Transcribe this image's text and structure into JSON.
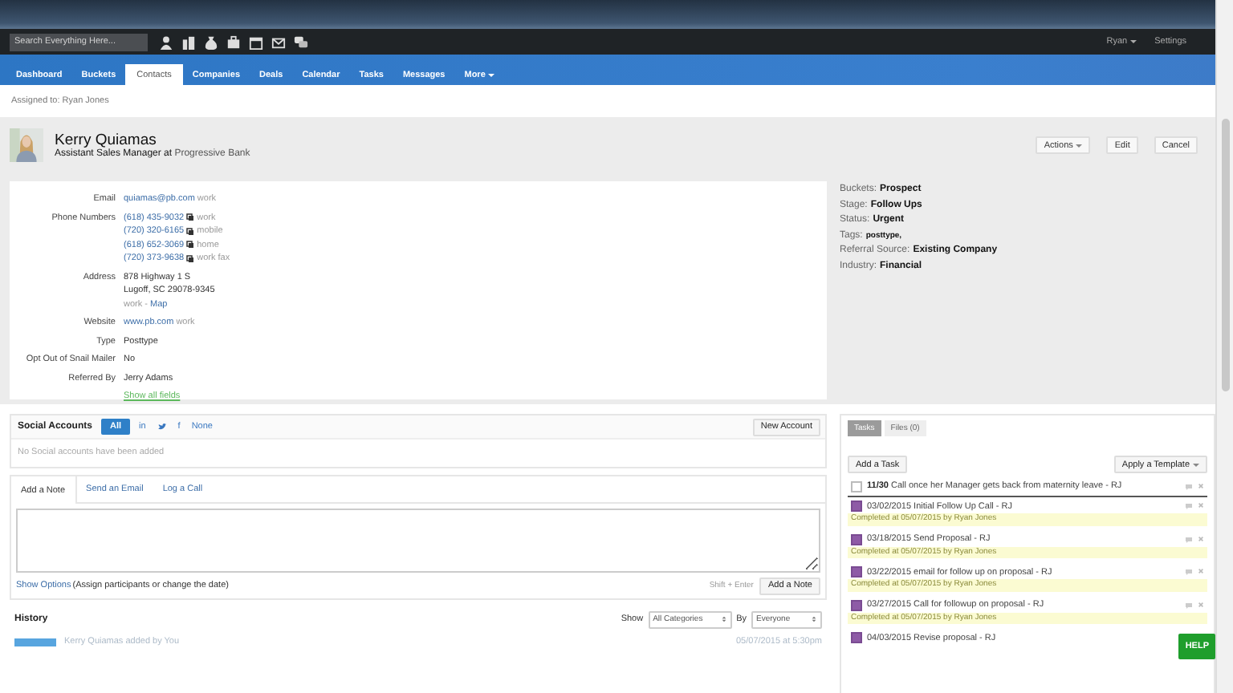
{
  "search": {
    "placeholder": "Search Everything Here..."
  },
  "user_menu": {
    "label": "Ryan",
    "kind": "dropdown"
  },
  "settings": "Settings",
  "nav": [
    {
      "label": "Dashboard",
      "selected": false,
      "kind": "link"
    },
    {
      "label": "Buckets",
      "selected": false,
      "kind": "link"
    },
    {
      "label": "Contacts",
      "selected": true,
      "kind": "link"
    },
    {
      "label": "Companies",
      "selected": false,
      "kind": "link"
    },
    {
      "label": "Deals",
      "selected": false,
      "kind": "link"
    },
    {
      "label": "Calendar",
      "selected": false,
      "kind": "link"
    },
    {
      "label": "Tasks",
      "selected": false,
      "kind": "link"
    },
    {
      "label": "Messages",
      "selected": false,
      "kind": "link"
    },
    {
      "label": "More",
      "selected": false,
      "kind": "dropdown"
    }
  ],
  "assigned": "Assigned to: Ryan Jones",
  "contact": {
    "name": "Kerry Quiamas",
    "title": "Assistant Sales Manager",
    "at": "at",
    "company": "Progressive Bank"
  },
  "actions": [
    {
      "label": "Actions",
      "kind": "dropdown"
    },
    {
      "label": "Edit",
      "kind": "button"
    },
    {
      "label": "Cancel",
      "kind": "button"
    }
  ],
  "fields": [
    {
      "label": "Email",
      "lines": [
        [
          {
            "text": "quiamas@pb.com",
            "kind": "link"
          },
          {
            "text": "work",
            "kind": "note"
          }
        ]
      ]
    },
    {
      "label": "Phone Numbers",
      "lines": [
        [
          {
            "text": "(618) 435-9032",
            "kind": "phone"
          },
          {
            "text": "work",
            "kind": "note"
          }
        ],
        [
          {
            "text": "(720) 320-6165",
            "kind": "phone"
          },
          {
            "text": "mobile",
            "kind": "note"
          }
        ],
        [
          {
            "text": "(618) 652-3069",
            "kind": "phone"
          },
          {
            "text": "home",
            "kind": "note"
          }
        ],
        [
          {
            "text": "(720) 373-9638",
            "kind": "phone"
          },
          {
            "text": "work fax",
            "kind": "note"
          }
        ]
      ]
    },
    {
      "label": "Address",
      "lines": [
        [
          {
            "text": "878 Highway 1 S",
            "kind": "plain"
          }
        ],
        [
          {
            "text": "Lugoff, SC 29078-9345",
            "kind": "plain"
          }
        ],
        [
          {
            "text": "work -",
            "kind": "note"
          },
          {
            "text": "Map",
            "kind": "link"
          }
        ]
      ]
    },
    {
      "label": "Website",
      "lines": [
        [
          {
            "text": "www.pb.com",
            "kind": "link"
          },
          {
            "text": "work",
            "kind": "note"
          }
        ]
      ]
    },
    {
      "label": "Type",
      "lines": [
        [
          {
            "text": "Posttype",
            "kind": "plain"
          }
        ]
      ]
    },
    {
      "label": "Opt Out of Snail Mailer",
      "lines": [
        [
          {
            "text": "No",
            "kind": "plain"
          }
        ]
      ]
    },
    {
      "label": "Referred By",
      "lines": [
        [
          {
            "text": "Jerry Adams",
            "kind": "plain"
          }
        ]
      ]
    }
  ],
  "show_all": "Show all fields",
  "summary": [
    {
      "label": "Buckets:",
      "value": "Prospect"
    },
    {
      "label": "Stage:",
      "value": "Follow Ups"
    },
    {
      "label": "Status:",
      "value": "Urgent"
    },
    {
      "label": "Tags:",
      "value": "posttype,"
    },
    {
      "label": "Referral Source:",
      "value": "Existing Company"
    },
    {
      "label": "Industry:",
      "value": "Financial"
    }
  ],
  "social": {
    "title": "Social Accounts",
    "filters": [
      {
        "kind": "text",
        "label": "All",
        "selected": true
      },
      {
        "kind": "text",
        "label": "in",
        "selected": false
      },
      {
        "kind": "bird",
        "selected": false
      },
      {
        "kind": "text",
        "label": "f",
        "selected": false
      },
      {
        "kind": "text",
        "label": "None",
        "selected": false
      }
    ],
    "new_account": "New Account",
    "empty": "No Social accounts have been added"
  },
  "note_tabs": [
    {
      "label": "Add a Note",
      "selected": true
    },
    {
      "label": "Send an Email",
      "selected": false
    },
    {
      "label": "Log a Call",
      "selected": false
    }
  ],
  "show_options": "Show Options",
  "options_hint": "(Assign participants or change the date)",
  "shortcut": "Shift + Enter",
  "add_note": "Add a Note",
  "history": {
    "title": "History",
    "show_label": "Show",
    "category": "All Categories",
    "by_label": "By",
    "person": "Everyone",
    "entry": {
      "text": "Kerry Quiamas added by You",
      "time": "05/07/2015 at 5:30pm"
    }
  },
  "task_tabs": [
    {
      "label": "Tasks",
      "selected": true
    },
    {
      "label": "Files (0)",
      "selected": false
    }
  ],
  "add_task": "Add a Task",
  "apply_template": "Apply a Template",
  "tasks": [
    {
      "date": "11/30",
      "text": "Call once her Manager gets back from maternity leave - RJ",
      "completed": false
    },
    {
      "date": "03/02/2015",
      "text": "Initial Follow Up Call - RJ",
      "completed": true,
      "note": "Completed at 05/07/2015 by Ryan Jones"
    },
    {
      "date": "03/18/2015",
      "text": "Send Proposal - RJ",
      "completed": true,
      "note": "Completed at 05/07/2015 by Ryan Jones"
    },
    {
      "date": "03/22/2015",
      "text": "email for follow up on proposal - RJ",
      "completed": true,
      "note": "Completed at 05/07/2015 by Ryan Jones"
    },
    {
      "date": "03/27/2015",
      "text": "Call for followup on proposal - RJ",
      "completed": true,
      "note": "Completed at 05/07/2015 by Ryan Jones"
    },
    {
      "date": "04/03/2015",
      "text": "Revise proposal - RJ",
      "completed": true
    }
  ],
  "help": "HELP"
}
